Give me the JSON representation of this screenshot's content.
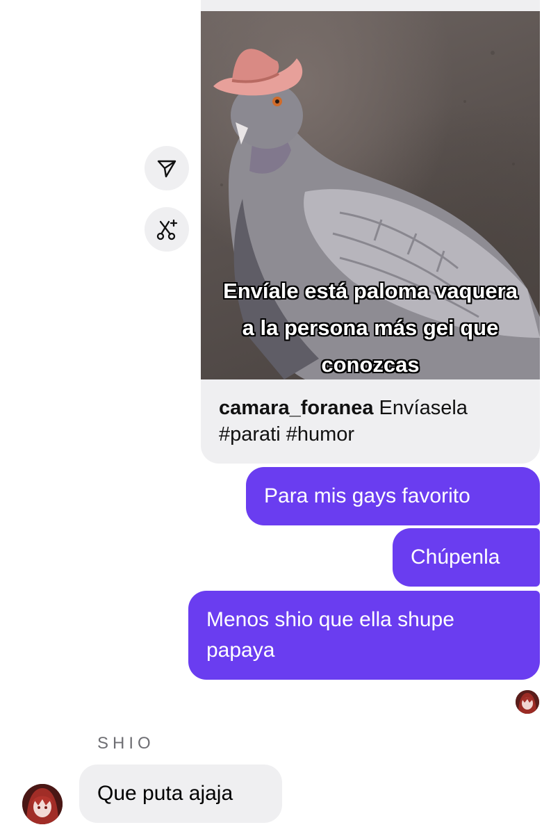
{
  "shared_post": {
    "overlay_lines": [
      "Envíale está paloma vaquera",
      "a la persona más gei que",
      "conozcas"
    ],
    "username": "camara_foranea",
    "caption": "Envíasela #parati #humor"
  },
  "side_actions": [
    {
      "icon": "send-icon"
    },
    {
      "icon": "remix-icon"
    }
  ],
  "messages": {
    "outgoing": [
      "Para mis gays favorito",
      "Chúpenla",
      "Menos shio que ella shupe papaya"
    ],
    "incoming_sender": "SHIO",
    "incoming": [
      "Que puta ajaja"
    ]
  },
  "colors": {
    "outgoing_bubble": "#6a3df0",
    "incoming_bubble": "#efeff1",
    "sender_label": "#6e6e73"
  }
}
